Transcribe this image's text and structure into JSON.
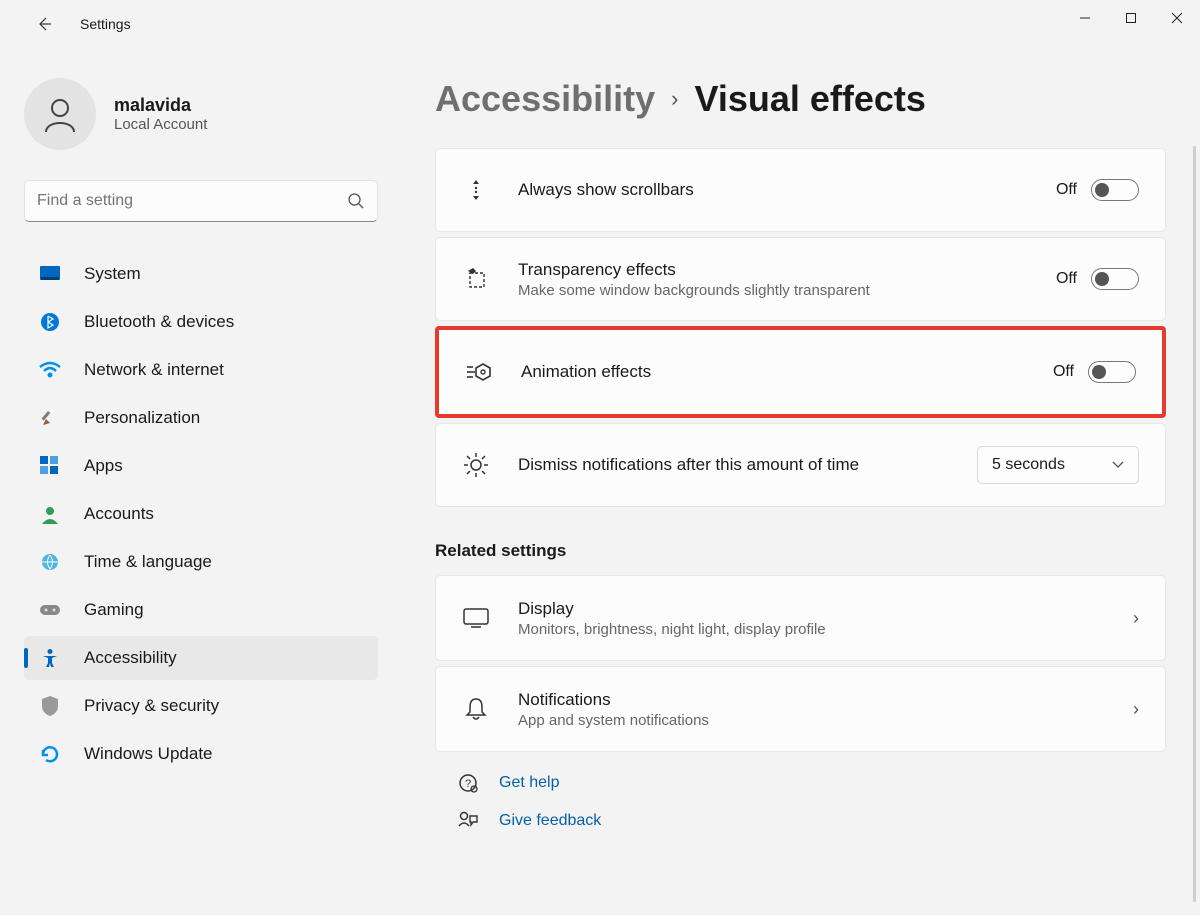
{
  "window": {
    "title": "Settings"
  },
  "user": {
    "name": "malavida",
    "account_type": "Local Account"
  },
  "search": {
    "placeholder": "Find a setting"
  },
  "sidebar": {
    "items": [
      {
        "id": "system",
        "label": "System"
      },
      {
        "id": "bluetooth",
        "label": "Bluetooth & devices"
      },
      {
        "id": "network",
        "label": "Network & internet"
      },
      {
        "id": "personalization",
        "label": "Personalization"
      },
      {
        "id": "apps",
        "label": "Apps"
      },
      {
        "id": "accounts",
        "label": "Accounts"
      },
      {
        "id": "time",
        "label": "Time & language"
      },
      {
        "id": "gaming",
        "label": "Gaming"
      },
      {
        "id": "accessibility",
        "label": "Accessibility"
      },
      {
        "id": "privacy",
        "label": "Privacy & security"
      },
      {
        "id": "update",
        "label": "Windows Update"
      }
    ]
  },
  "breadcrumb": {
    "parent": "Accessibility",
    "current": "Visual effects"
  },
  "cards": {
    "scrollbars": {
      "title": "Always show scrollbars",
      "state": "Off"
    },
    "transparency": {
      "title": "Transparency effects",
      "subtitle": "Make some window backgrounds slightly transparent",
      "state": "Off"
    },
    "animation": {
      "title": "Animation effects",
      "state": "Off"
    },
    "notifications": {
      "title": "Dismiss notifications after this amount of time",
      "value": "5 seconds"
    }
  },
  "related": {
    "header": "Related settings",
    "display": {
      "title": "Display",
      "subtitle": "Monitors, brightness, night light, display profile"
    },
    "notifications": {
      "title": "Notifications",
      "subtitle": "App and system notifications"
    }
  },
  "help_links": {
    "get_help": "Get help",
    "feedback": "Give feedback"
  }
}
